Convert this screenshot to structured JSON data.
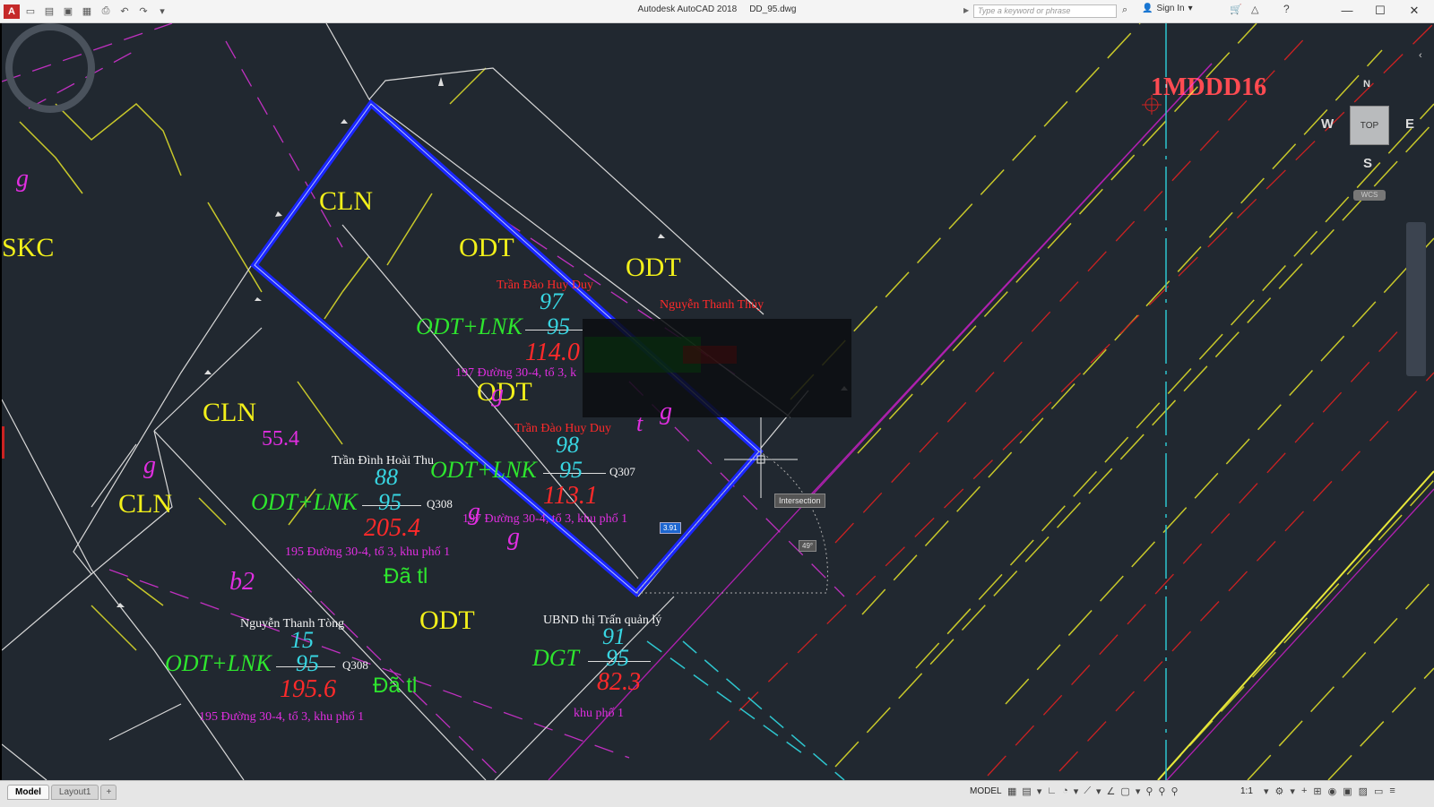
{
  "window": {
    "app_name": "Autodesk AutoCAD 2018",
    "file_name": "DD_95.dwg",
    "search_placeholder": "Type a keyword or phrase",
    "sign_in": "Sign In",
    "minimize": "—",
    "maximize": "☐",
    "close": "✕"
  },
  "qat": {
    "logo": "A",
    "icons": [
      "new-icon",
      "open-icon",
      "save-icon",
      "saveas-icon",
      "print-icon",
      "undo-icon",
      "redo-icon",
      "more-icon"
    ]
  },
  "viewport": {
    "viewcube": {
      "top": "TOP",
      "north": "N",
      "south": "S",
      "east": "E",
      "west": "W",
      "wcs": "WCS"
    },
    "close_glyph": "‹",
    "snap_tooltip": "Intersection",
    "dynamic_input": "3.91",
    "angle_tooltip": "49°"
  },
  "drawing": {
    "corner_label": "1MDDD16",
    "landuse": [
      "CLN",
      "ODT",
      "ODT",
      "SKC",
      "CLN",
      "ODT",
      "CLN",
      "ODT"
    ],
    "parcels": [
      {
        "owner": "Trần Đào Huy Duy",
        "no": "97",
        "code": "ODT+LNK",
        "sheet": "95",
        "area": "114.0",
        "address": "197 Đường 30-4, tổ 3, k"
      },
      {
        "owner": "Trần Đào Huy Duy",
        "no": "98",
        "code": "ODT+LNK",
        "sheet": "95",
        "area": "113.1",
        "address": "197 Đường 30-4, tổ 3, khu phố 1",
        "q": "Q307"
      },
      {
        "owner": "Trần Đình Hoài Thu",
        "no": "88",
        "code": "ODT+LNK",
        "sheet": "95",
        "area": "205.4",
        "address": "195 Đường 30-4, tổ 3, khu phố 1",
        "q": "Q308"
      },
      {
        "owner": "Nguyễn Thanh Tòng",
        "no": "15",
        "code": "ODT+LNK",
        "sheet": "95",
        "area": "195.6",
        "address": "195 Đường 30-4, tổ 3, khu phố 1",
        "q": "Q308"
      },
      {
        "owner": "UBND thị Trấn quản lý",
        "no": "91",
        "code": "DGT",
        "sheet": "95",
        "area": "82.3",
        "address": "khu phố 1"
      }
    ],
    "owner_top_right": "Nguyễn Thanh Thủy",
    "misc": {
      "g_labels": [
        "g",
        "g",
        "g",
        "g",
        "g",
        "g"
      ],
      "t_label": "t",
      "b2_label": "b2",
      "area_cln": "55.4",
      "da_tl": "Đã tl",
      "da_tl_2": "Đã tl"
    }
  },
  "status": {
    "tab_model": "Model",
    "tab_layout": "Layout1",
    "tab_plus": "+",
    "model": "MODEL",
    "scale": "1:1"
  },
  "colors": {
    "canvas": "#212830",
    "selection": "#1a26ff",
    "landuse_text": "#f2f01a",
    "code_text": "#2ee52e",
    "number_text": "#38d6e2",
    "area_text": "#ff2a2a",
    "address_text": "#e02ee0"
  }
}
